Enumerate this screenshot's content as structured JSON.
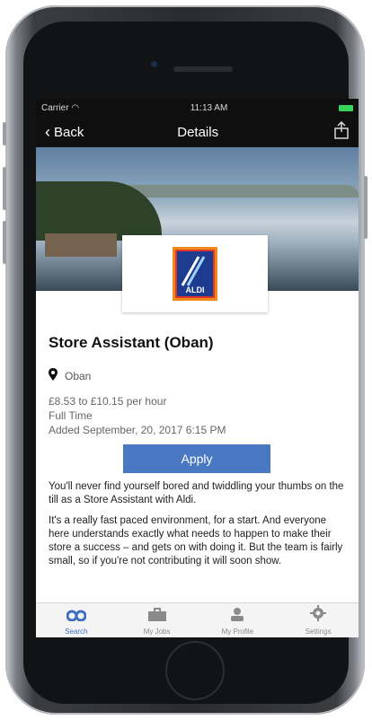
{
  "status_bar": {
    "carrier": "Carrier",
    "time": "11:13 AM"
  },
  "nav": {
    "back_label": "Back",
    "title": "Details"
  },
  "logo": {
    "text": "ALDI"
  },
  "job": {
    "title": "Store Assistant (Oban)",
    "location": "Oban",
    "pay": "£8.53 to £10.15 per hour",
    "type": "Full Time",
    "added": "Added September, 20, 2017 6:15 PM"
  },
  "apply_label": "Apply",
  "description": [
    "You'll never find yourself bored and twiddling your thumbs on the till as a Store Assistant with Aldi.",
    "It's a really fast paced environment, for a start. And everyone here understands exactly what needs to happen to make their store a success – and gets on with doing it. But the team is fairly small, so if you're not contributing it will soon show."
  ],
  "tabs": [
    {
      "label": "Search",
      "icon": "binoculars-icon",
      "active": true
    },
    {
      "label": "My Jobs",
      "icon": "briefcase-icon",
      "active": false
    },
    {
      "label": "My Profile",
      "icon": "person-icon",
      "active": false
    },
    {
      "label": "Settings",
      "icon": "gear-icon",
      "active": false
    }
  ],
  "colors": {
    "accent": "#4a78c2",
    "battery": "#39d45b",
    "nav_bg": "#0f0f10"
  }
}
